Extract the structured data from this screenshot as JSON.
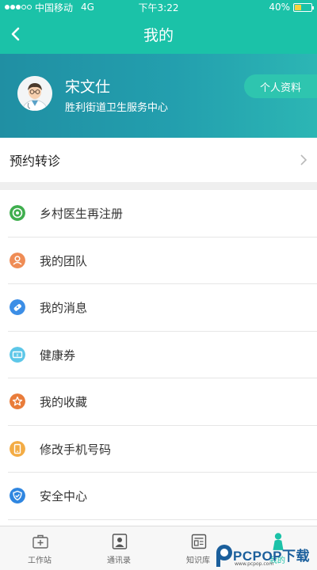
{
  "status_bar": {
    "carrier": "中国移动",
    "network": "4G",
    "time": "下午3:22",
    "battery": "40%",
    "battery_level": 0.4
  },
  "nav": {
    "title": "我的",
    "back_icon": "chevron-left-icon"
  },
  "profile": {
    "name": "宋文仕",
    "org": "胜利街道卫生服务中心",
    "profile_button": "个人资料",
    "avatar_icon": "doctor-avatar-icon"
  },
  "referral": {
    "label": "预约转诊",
    "icon": "chevron-right-icon"
  },
  "menu": {
    "items": [
      {
        "label": "乡村医生再注册",
        "icon": "target-icon",
        "color": "#3fae4e"
      },
      {
        "label": "我的团队",
        "icon": "user-icon",
        "color": "#ef8c55"
      },
      {
        "label": "我的消息",
        "icon": "message-icon",
        "color": "#3c8ee6"
      },
      {
        "label": "健康券",
        "icon": "ticket-icon",
        "color": "#5dc7e8"
      },
      {
        "label": "我的收藏",
        "icon": "star-icon",
        "color": "#e97c3a"
      },
      {
        "label": "修改手机号码",
        "icon": "phone-icon",
        "color": "#f3ac45"
      },
      {
        "label": "安全中心",
        "icon": "shield-icon",
        "color": "#2f86e0"
      }
    ]
  },
  "tabbar": {
    "tabs": [
      {
        "label": "工作站",
        "icon": "medical-kit-icon"
      },
      {
        "label": "通讯录",
        "icon": "contacts-icon"
      },
      {
        "label": "知识库",
        "icon": "document-icon"
      },
      {
        "label": "我的",
        "icon": "person-icon"
      }
    ]
  },
  "watermark": {
    "text": "PCPOP下载",
    "sub": "www.pcpop.com"
  },
  "colors": {
    "header": "#1bc2a8",
    "accent": "#2ec5af"
  }
}
